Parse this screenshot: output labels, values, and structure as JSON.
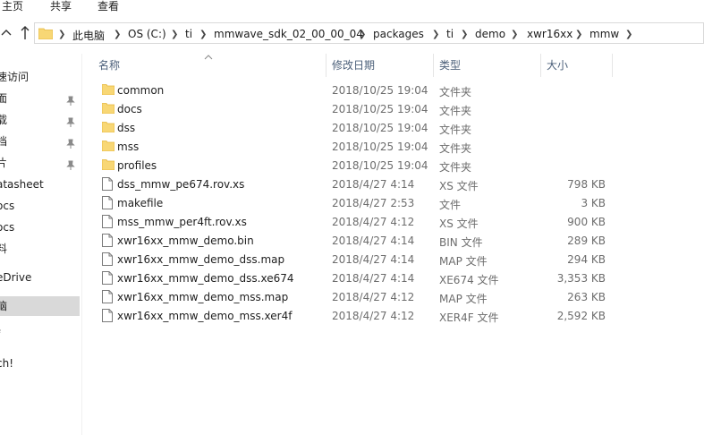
{
  "ribbon": {
    "tabs": [
      "主页",
      "共享",
      "查看"
    ]
  },
  "address": {
    "crumbs": [
      "此电脑",
      "OS (C:)",
      "ti",
      "mmwave_sdk_02_00_00_04",
      "packages",
      "ti",
      "demo",
      "xwr16xx",
      "mmw"
    ]
  },
  "nav": {
    "items": [
      {
        "label": "速访问",
        "pinned": false
      },
      {
        "label": "面",
        "pinned": true
      },
      {
        "label": "载",
        "pinned": true
      },
      {
        "label": "档",
        "pinned": true
      },
      {
        "label": "片",
        "pinned": true
      },
      {
        "label": "atasheet",
        "pinned": false
      },
      {
        "label": "ocs",
        "pinned": false
      },
      {
        "label": "ocs",
        "pinned": false
      },
      {
        "label": "料",
        "pinned": false
      },
      {
        "label": "eDrive",
        "pinned": false
      },
      {
        "label": "脑",
        "pinned": false,
        "selected": true
      },
      {
        "label": "f",
        "pinned": false
      },
      {
        "label": "ch!",
        "pinned": false
      }
    ]
  },
  "columns": {
    "name": "名称",
    "date": "修改日期",
    "type": "类型",
    "size": "大小"
  },
  "files": [
    {
      "name": "common",
      "date": "2018/10/25 19:04",
      "type": "文件夹",
      "size": "",
      "kind": "folder"
    },
    {
      "name": "docs",
      "date": "2018/10/25 19:04",
      "type": "文件夹",
      "size": "",
      "kind": "folder"
    },
    {
      "name": "dss",
      "date": "2018/10/25 19:04",
      "type": "文件夹",
      "size": "",
      "kind": "folder"
    },
    {
      "name": "mss",
      "date": "2018/10/25 19:04",
      "type": "文件夹",
      "size": "",
      "kind": "folder"
    },
    {
      "name": "profiles",
      "date": "2018/10/25 19:04",
      "type": "文件夹",
      "size": "",
      "kind": "folder"
    },
    {
      "name": "dss_mmw_pe674.rov.xs",
      "date": "2018/4/27 4:14",
      "type": "XS 文件",
      "size": "798 KB",
      "kind": "file"
    },
    {
      "name": "makefile",
      "date": "2018/4/27 2:53",
      "type": "文件",
      "size": "3 KB",
      "kind": "file"
    },
    {
      "name": "mss_mmw_per4ft.rov.xs",
      "date": "2018/4/27 4:12",
      "type": "XS 文件",
      "size": "900 KB",
      "kind": "file"
    },
    {
      "name": "xwr16xx_mmw_demo.bin",
      "date": "2018/4/27 4:14",
      "type": "BIN 文件",
      "size": "289 KB",
      "kind": "file"
    },
    {
      "name": "xwr16xx_mmw_demo_dss.map",
      "date": "2018/4/27 4:14",
      "type": "MAP 文件",
      "size": "294 KB",
      "kind": "file"
    },
    {
      "name": "xwr16xx_mmw_demo_dss.xe674",
      "date": "2018/4/27 4:14",
      "type": "XE674 文件",
      "size": "3,353 KB",
      "kind": "file"
    },
    {
      "name": "xwr16xx_mmw_demo_mss.map",
      "date": "2018/4/27 4:12",
      "type": "MAP 文件",
      "size": "263 KB",
      "kind": "file"
    },
    {
      "name": "xwr16xx_mmw_demo_mss.xer4f",
      "date": "2018/4/27 4:12",
      "type": "XER4F 文件",
      "size": "2,592 KB",
      "kind": "file"
    }
  ],
  "colors": {
    "folder": "#f8d775",
    "folder_dark": "#e5b73b",
    "selected_nav": "#d9d9d9",
    "header_text": "#4c607a"
  }
}
